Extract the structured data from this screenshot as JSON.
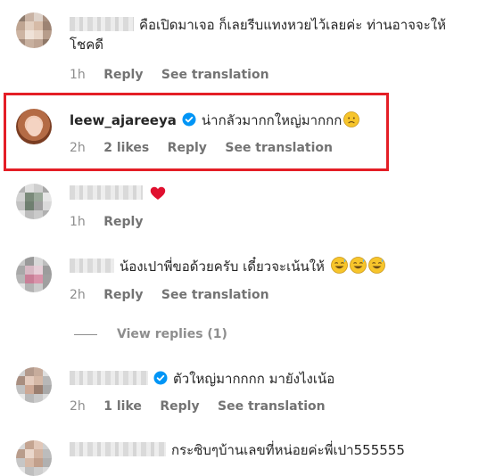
{
  "comments": [
    {
      "text_line1": "คือเปิดมาเจอ ก็เลยรีบแทงหวยไว้เลยค่ะ ท่านอาจจะให้",
      "text_line2": "โชคดี",
      "time": "1h",
      "reply": "Reply",
      "translate": "See translation"
    },
    {
      "username": "leew_ajareeya",
      "text": "น่ากลัวมากกใหญ่มากกก",
      "time": "2h",
      "likes": "2 likes",
      "reply": "Reply",
      "translate": "See translation"
    },
    {
      "time": "1h",
      "reply": "Reply"
    },
    {
      "text": "น้องเปาพี่ขอด้วยครับ เดี๋ยวจะเน้นให้",
      "time": "2h",
      "reply": "Reply",
      "translate": "See translation",
      "view_replies": "View replies (1)"
    },
    {
      "text": "ตัวใหญ่มากกกก มายังไงเน้อ",
      "time": "2h",
      "likes": "1 like",
      "reply": "Reply",
      "translate": "See translation"
    },
    {
      "text": "กระซิบๆบ้านเลขที่หน่อยค่ะพี่เปา555555"
    }
  ],
  "colors": {
    "highlight": "#e41e26",
    "verified": "#0095f6",
    "meta_gray": "#8e8e8e"
  },
  "icons": [
    "verified-badge-icon",
    "sad-face-emoji",
    "red-heart-emoji",
    "grinning-sweat-emoji"
  ]
}
